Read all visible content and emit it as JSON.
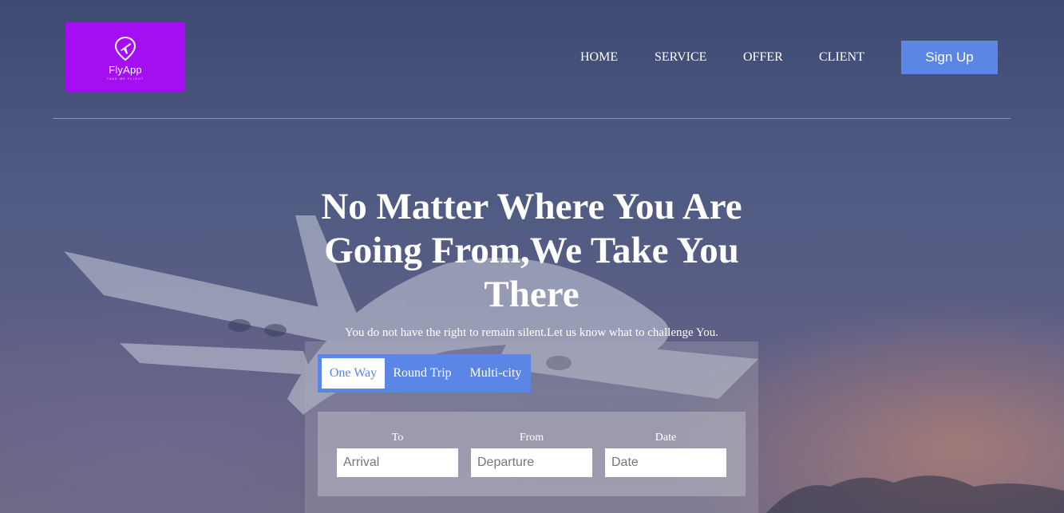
{
  "brand": {
    "name": "FlyApp",
    "tagline": "TAKE ME FLIGHT",
    "logo_color": "#a40ff2"
  },
  "nav": {
    "items": [
      "HOME",
      "SERVICE",
      "OFFER",
      "CLIENT"
    ],
    "signup_label": "Sign Up"
  },
  "hero": {
    "title": "No Matter Where You Are Going From,We Take You There",
    "subtitle": "You do not have the right to remain silent.Let us know what to challenge You."
  },
  "trip_tabs": {
    "items": [
      "One Way",
      "Round Trip",
      "Multi-city"
    ],
    "selected": "One Way"
  },
  "form": {
    "to": {
      "label": "To",
      "placeholder": "Arrival"
    },
    "from": {
      "label": "From",
      "placeholder": "Departure"
    },
    "date": {
      "label": "Date",
      "placeholder": "Date"
    }
  },
  "colors": {
    "accent": "#5b86e5",
    "logo_bg": "#a40ff2"
  }
}
